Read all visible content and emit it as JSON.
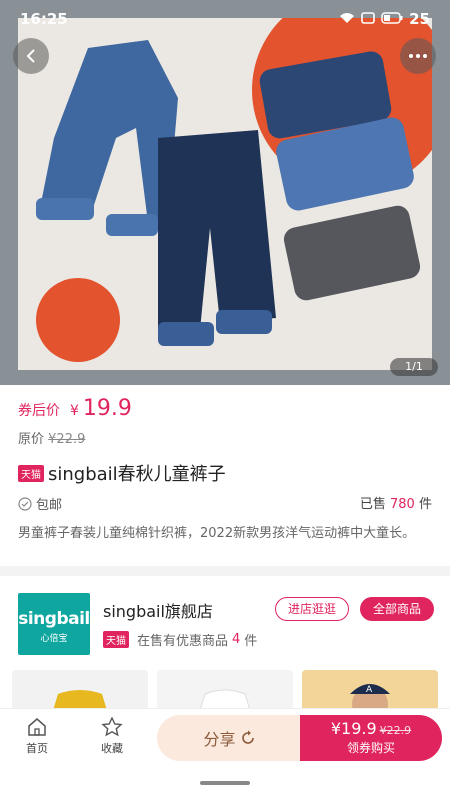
{
  "status_bar": {
    "time": "16:25",
    "battery": "25"
  },
  "hero": {
    "pager": "1/1"
  },
  "price": {
    "label": "券后价",
    "currency": "¥",
    "value": "19.9",
    "original_label": "原价",
    "original_value": "¥22.9"
  },
  "product": {
    "badge": "天猫",
    "title": "singbail春秋儿童裤子",
    "shipping": "包邮",
    "sold_label": "已售",
    "sold_count": "780",
    "sold_unit": "件",
    "description": "男童裤子春装儿童纯棉针织裤，2022新款男孩洋气运动裤中大童长。"
  },
  "shop": {
    "logo_main": "singbail",
    "logo_sub": "心倍宝",
    "name": "singbail旗舰店",
    "badge": "天猫",
    "promo_prefix": "在售有优惠商品",
    "promo_count": "4",
    "promo_unit": "件",
    "visit_label": "进店逛逛",
    "all_label": "全部商品"
  },
  "bottom_nav": {
    "home_label": "首页",
    "fav_label": "收藏",
    "share_label": "分享",
    "buy_price": "¥19.9",
    "buy_original": "¥22.9",
    "buy_label": "领券购买"
  },
  "colors": {
    "accent": "#e0245e",
    "shop_logo": "#0fa6a0",
    "share_bg": "#fbe9dd"
  }
}
